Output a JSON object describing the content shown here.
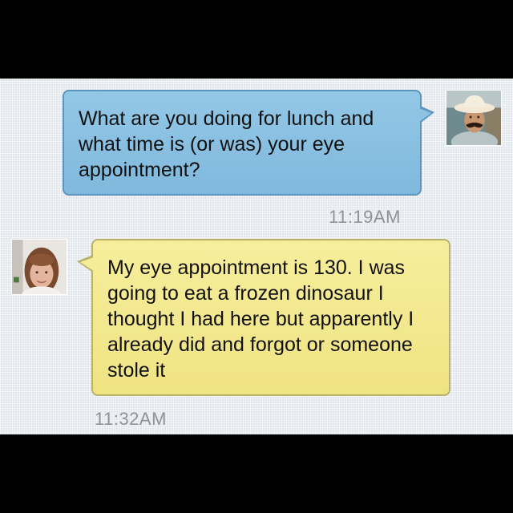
{
  "conversation": {
    "messages": [
      {
        "direction": "outgoing",
        "text": "What are you doing for lunch and what time is (or was) your eye appointment?",
        "time": "11:19AM",
        "avatar": "cowboy-mustache-avatar"
      },
      {
        "direction": "incoming",
        "text": "My eye appointment is 130. I was going to eat a frozen dinosaur I thought I had here but apparently I already did and forgot or someone stole it",
        "time": "11:32AM",
        "avatar": "woman-avatar"
      }
    ]
  },
  "colors": {
    "outgoing_bubble": "#87bfe1",
    "incoming_bubble": "#f3e98d",
    "background": "#dfe5ea",
    "timestamp": "#8e9399"
  }
}
